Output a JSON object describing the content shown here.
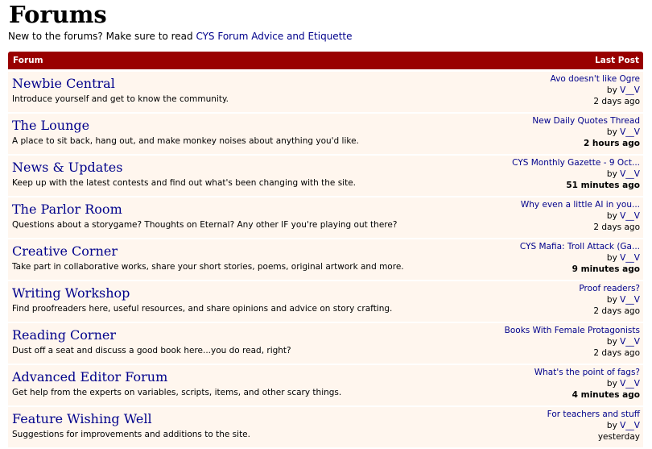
{
  "page": {
    "title": "Forums",
    "intro_text": "New to the forums? Make sure to read ",
    "intro_link": "CYS Forum Advice and Etiquette"
  },
  "table": {
    "header_forum": "Forum",
    "header_last_post": "Last Post"
  },
  "forums": [
    {
      "name": "Newbie Central",
      "desc": "Introduce yourself and get to know the community.",
      "last_title": "Avo doesn't like Ogre",
      "by": "by ",
      "user": "V__V",
      "time": "2 days ago",
      "recent": false
    },
    {
      "name": "The Lounge",
      "desc": "A place to sit back, hang out, and make monkey noises about anything you'd like.",
      "last_title": "New Daily Quotes Thread",
      "by": "by ",
      "user": "V__V",
      "time": "2 hours ago",
      "recent": true
    },
    {
      "name": "News & Updates",
      "desc": "Keep up with the latest contests and find out what's been changing with the site.",
      "last_title": "CYS Monthly Gazette - 9 Oct...",
      "by": "by ",
      "user": "V__V",
      "time": "51 minutes ago",
      "recent": true
    },
    {
      "name": "The Parlor Room",
      "desc": "Questions about a storygame? Thoughts on Eternal? Any other IF you're playing out there?",
      "last_title": "Why even a little AI in you...",
      "by": "by ",
      "user": "V__V",
      "time": "2 days ago",
      "recent": false
    },
    {
      "name": "Creative Corner",
      "desc": "Take part in collaborative works, share your short stories, poems, original artwork and more.",
      "last_title": "CYS Mafia: Troll Attack (Ga...",
      "by": "by ",
      "user": "V__V",
      "time": "9 minutes ago",
      "recent": true
    },
    {
      "name": "Writing Workshop",
      "desc": "Find proofreaders here, useful resources, and share opinions and advice on story crafting.",
      "last_title": "Proof readers?",
      "by": "by ",
      "user": "V__V",
      "time": "2 days ago",
      "recent": false
    },
    {
      "name": "Reading Corner",
      "desc": "Dust off a seat and discuss a good book here...you do read, right?",
      "last_title": "Books With Female Protagonists",
      "by": "by ",
      "user": "V__V",
      "time": "2 days ago",
      "recent": false
    },
    {
      "name": "Advanced Editor Forum",
      "desc": "Get help from the experts on variables, scripts, items, and other scary things.",
      "last_title": "What's the point of fags?",
      "by": "by ",
      "user": "V__V",
      "time": "4 minutes ago",
      "recent": true
    },
    {
      "name": "Feature Wishing Well",
      "desc": "Suggestions for improvements and additions to the site.",
      "last_title": "For teachers and stuff",
      "by": "by ",
      "user": "V__V",
      "time": "yesterday",
      "recent": false
    }
  ]
}
